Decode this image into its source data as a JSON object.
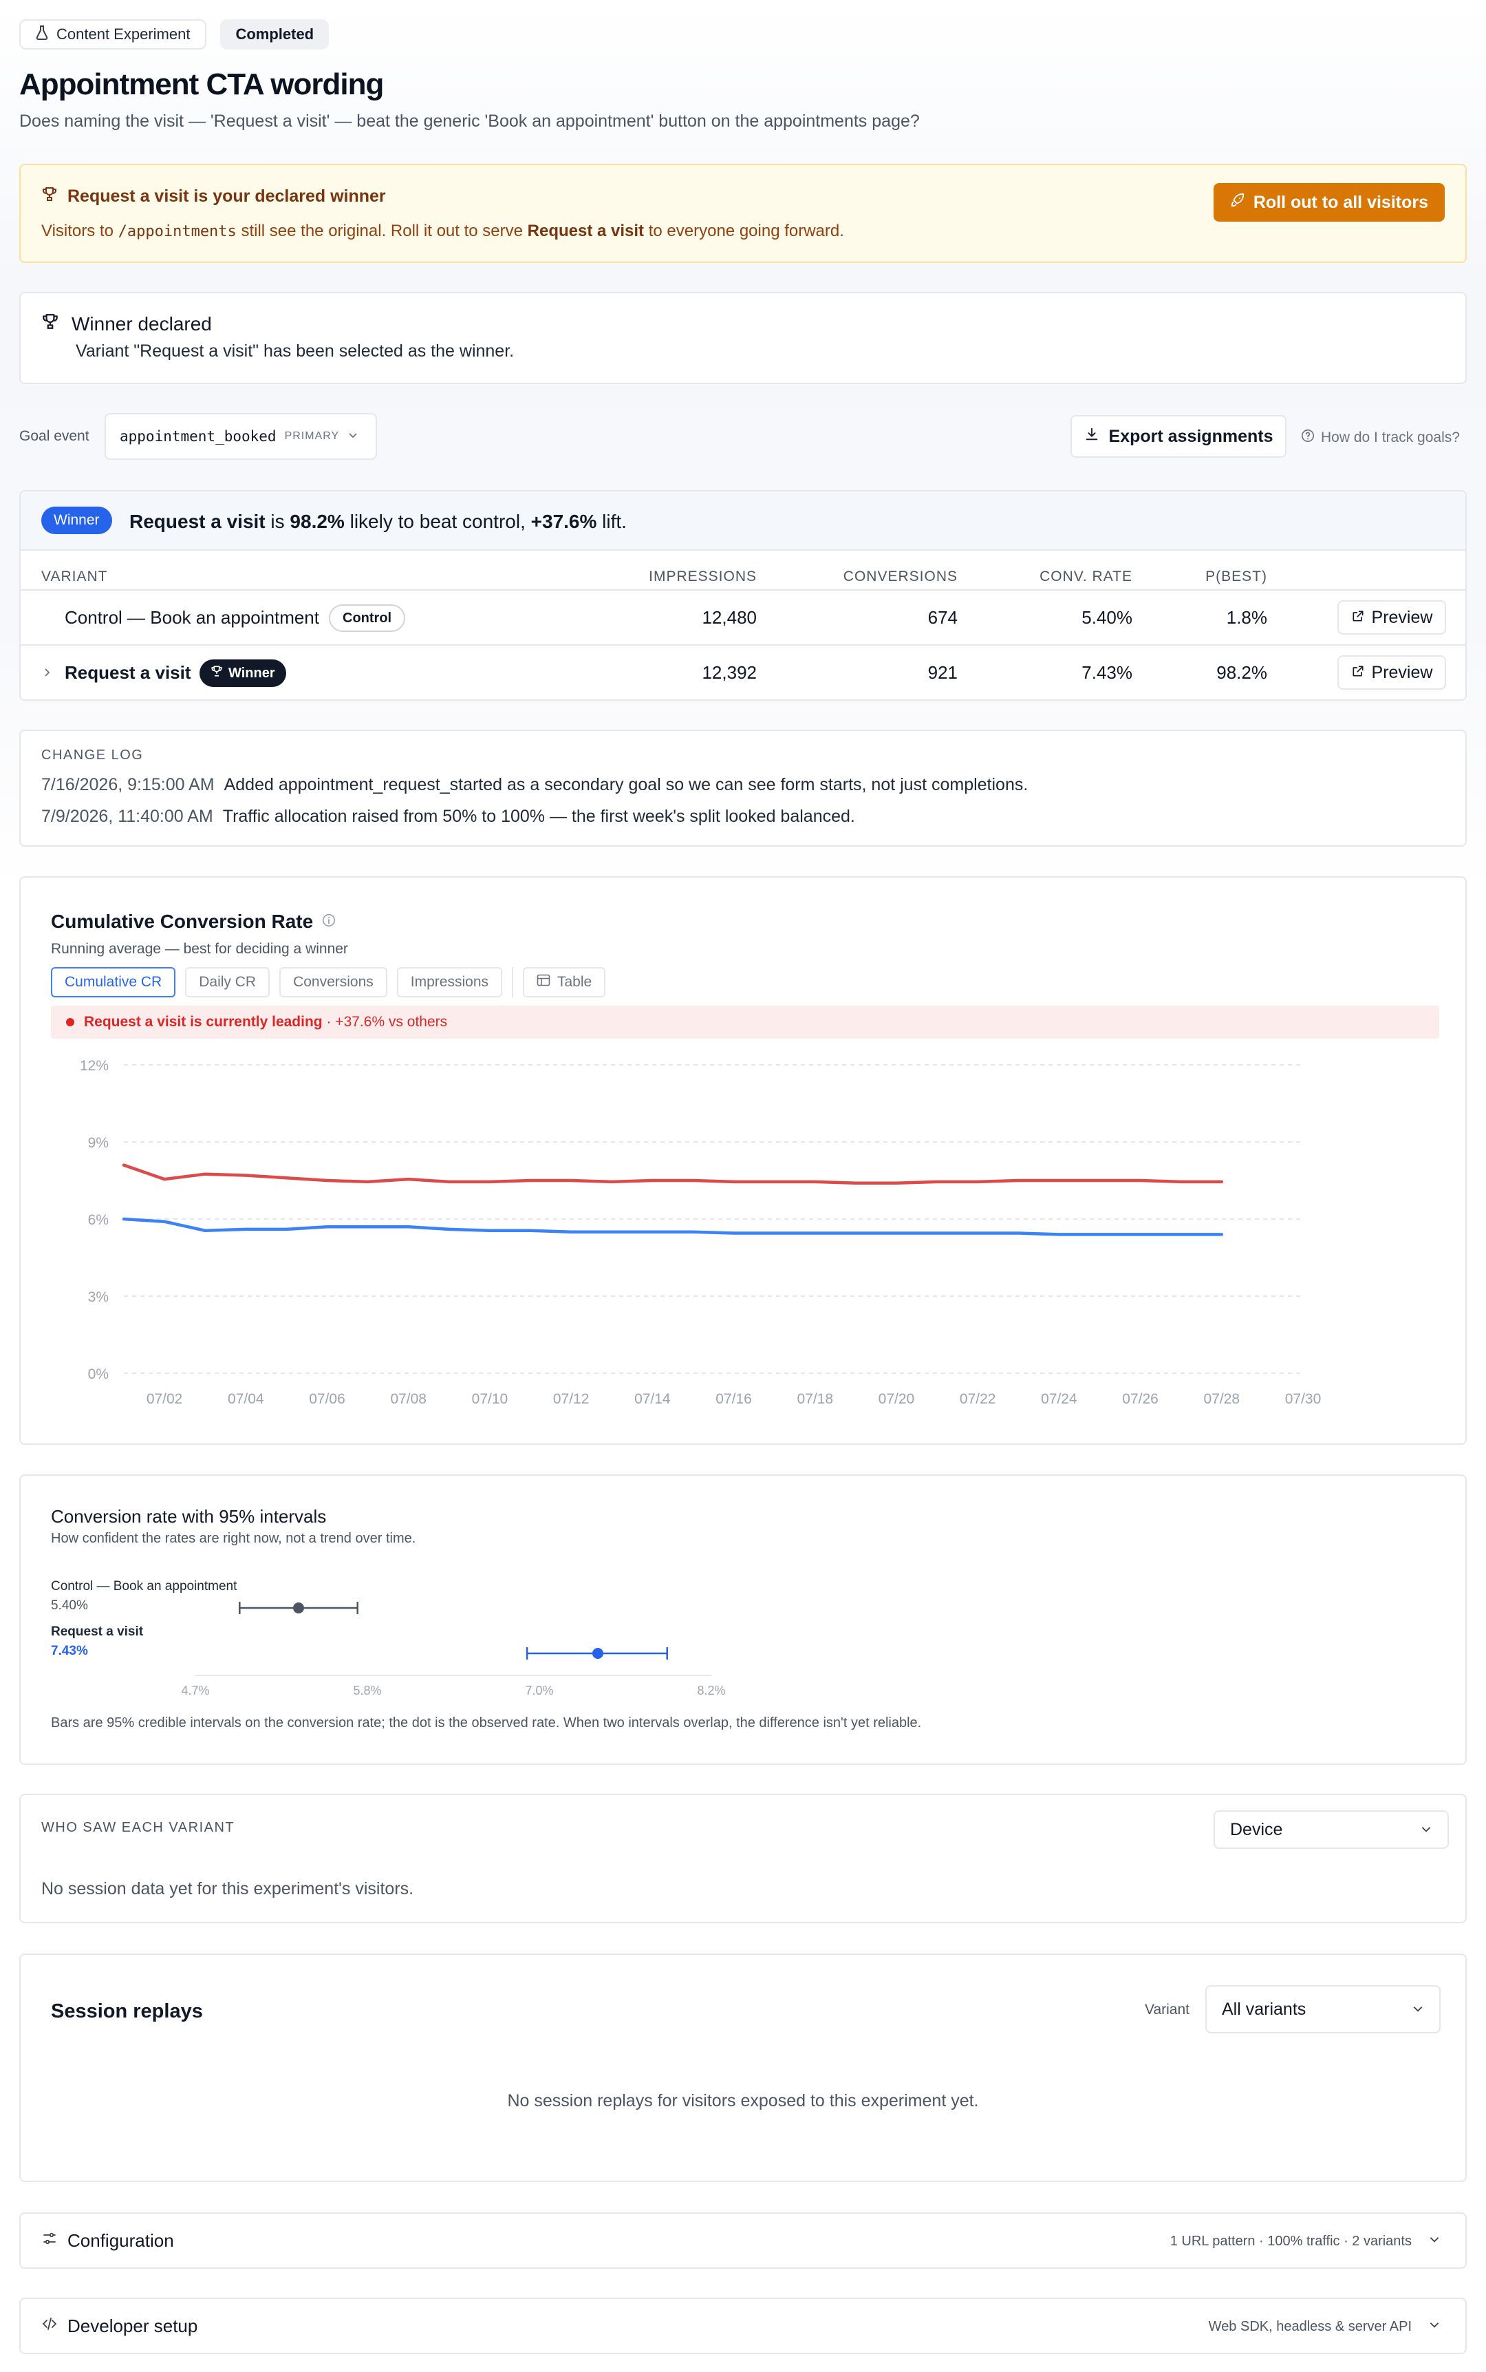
{
  "header": {
    "type_pill": "Content Experiment",
    "status_pill": "Completed",
    "title": "Appointment CTA wording",
    "subtitle": "Does naming the visit — 'Request a visit' — beat the generic 'Book an appointment' button on the appointments page?"
  },
  "banner": {
    "winner_name": "Request a visit",
    "title_suffix": " is your declared winner",
    "text_a": "Visitors to ",
    "path": "/appointments",
    "text_b": " still see the original. Roll it out to serve ",
    "text_c": " to everyone going forward.",
    "rollout_label": "Roll out to all visitors",
    "accent": "#d97706"
  },
  "declared": {
    "title": "Winner declared",
    "text": "Variant \"Request a visit\" has been selected as the winner."
  },
  "goal": {
    "label": "Goal event",
    "event": "appointment_booked",
    "tier": "PRIMARY",
    "export_label": "Export assignments",
    "help_label": "How do I track goals?"
  },
  "results": {
    "badge": "Winner",
    "summary_name": "Request a visit",
    "summary_a": " is ",
    "summary_prob": "98.2%",
    "summary_b": " likely to beat control, ",
    "summary_lift": "+37.6%",
    "summary_c": " lift.",
    "columns": [
      "VARIANT",
      "IMPRESSIONS",
      "CONVERSIONS",
      "CONV. RATE",
      "P(BEST)"
    ],
    "preview_label": "Preview",
    "rows": [
      {
        "name": "Control — Book an appointment",
        "tag": "Control",
        "impressions": "12,480",
        "conversions": "674",
        "rate": "5.40%",
        "pbest": "1.8%"
      },
      {
        "name": "Request a visit",
        "tag": "Winner",
        "impressions": "12,392",
        "conversions": "921",
        "rate": "7.43%",
        "pbest": "98.2%"
      }
    ]
  },
  "changelog": {
    "label": "CHANGE LOG",
    "entries": [
      {
        "time": "7/16/2026, 9:15:00 AM",
        "text": "Added appointment_request_started as a secondary goal so we can see form starts, not just completions."
      },
      {
        "time": "7/9/2026, 11:40:00 AM",
        "text": "Traffic allocation raised from 50% to 100% — the first week's split looked balanced."
      }
    ]
  },
  "chart": {
    "title": "Cumulative Conversion Rate",
    "subtitle": "Running average — best for deciding a winner",
    "tabs": [
      "Cumulative CR",
      "Daily CR",
      "Conversions",
      "Impressions",
      "Table"
    ],
    "leading_name": "Request a visit",
    "leading_text": " is currently leading",
    "leading_lift": " · +37.6% vs others"
  },
  "chart_data": [
    {
      "type": "line",
      "title": "Cumulative Conversion Rate",
      "ylim": [
        0,
        12
      ],
      "yticks": [
        "0%",
        "3%",
        "6%",
        "9%",
        "12%"
      ],
      "xlim": [
        1,
        30
      ],
      "xticks": [
        {
          "x": 2,
          "label": "07/02"
        },
        {
          "x": 4,
          "label": "07/04"
        },
        {
          "x": 6,
          "label": "07/06"
        },
        {
          "x": 8,
          "label": "07/08"
        },
        {
          "x": 10,
          "label": "07/10"
        },
        {
          "x": 12,
          "label": "07/12"
        },
        {
          "x": 14,
          "label": "07/14"
        },
        {
          "x": 16,
          "label": "07/16"
        },
        {
          "x": 18,
          "label": "07/18"
        },
        {
          "x": 20,
          "label": "07/20"
        },
        {
          "x": 22,
          "label": "07/22"
        },
        {
          "x": 24,
          "label": "07/24"
        },
        {
          "x": 26,
          "label": "07/26"
        },
        {
          "x": 28,
          "label": "07/28"
        },
        {
          "x": 30,
          "label": "07/30"
        }
      ],
      "grid": true,
      "series": [
        {
          "name": "Request a visit",
          "color": "#dc4a4a",
          "x": [
            1,
            2,
            3,
            4,
            5,
            6,
            7,
            8,
            9,
            10,
            11,
            12,
            13,
            14,
            15,
            16,
            17,
            18,
            19,
            20,
            21,
            22,
            23,
            24,
            25,
            26,
            27,
            28
          ],
          "values": [
            8.1,
            7.55,
            7.75,
            7.7,
            7.6,
            7.5,
            7.45,
            7.55,
            7.45,
            7.45,
            7.5,
            7.5,
            7.45,
            7.5,
            7.5,
            7.45,
            7.45,
            7.45,
            7.4,
            7.4,
            7.45,
            7.45,
            7.5,
            7.5,
            7.5,
            7.5,
            7.45,
            7.45
          ]
        },
        {
          "name": "Control — Book an appointment",
          "color": "#3b82f6",
          "x": [
            1,
            2,
            3,
            4,
            5,
            6,
            7,
            8,
            9,
            10,
            11,
            12,
            13,
            14,
            15,
            16,
            17,
            18,
            19,
            20,
            21,
            22,
            23,
            24,
            25,
            26,
            27,
            28
          ],
          "values": [
            6.0,
            5.9,
            5.55,
            5.6,
            5.6,
            5.7,
            5.7,
            5.7,
            5.6,
            5.55,
            5.55,
            5.5,
            5.5,
            5.5,
            5.5,
            5.45,
            5.45,
            5.45,
            5.45,
            5.45,
            5.45,
            5.45,
            5.45,
            5.4,
            5.4,
            5.4,
            5.4,
            5.4
          ]
        }
      ]
    },
    {
      "type": "scatter",
      "title": "Conversion rate with 95% intervals",
      "xlim": [
        4.7,
        8.2
      ],
      "xticks": [
        "4.7%",
        "5.8%",
        "7.0%",
        "8.2%"
      ],
      "series": [
        {
          "name": "Control — Book an appointment",
          "rate": 5.4,
          "rate_label": "5.40%",
          "lo": 5.0,
          "hi": 5.8,
          "color": "#4b5563"
        },
        {
          "name": "Request a visit",
          "rate": 7.43,
          "rate_label": "7.43%",
          "lo": 6.95,
          "hi": 7.9,
          "color": "#2563eb"
        }
      ]
    }
  ],
  "ci": {
    "title": "Conversion rate with 95% intervals",
    "subtitle": "How confident the rates are right now, not a trend over time.",
    "note": "Bars are 95% credible intervals on the conversion rate; the dot is the observed rate. When two intervals overlap, the difference isn't yet reliable."
  },
  "who": {
    "label": "WHO SAW EACH VARIANT",
    "select": "Device",
    "empty": "No session data yet for this experiment's visitors."
  },
  "replays": {
    "title": "Session replays",
    "filter_label": "Variant",
    "select": "All variants",
    "empty": "No session replays for visitors exposed to this experiment yet."
  },
  "configuration": {
    "title": "Configuration",
    "meta": "1 URL pattern · 100% traffic · 2 variants"
  },
  "developer": {
    "title": "Developer setup",
    "meta": "Web SDK, headless & server API"
  }
}
